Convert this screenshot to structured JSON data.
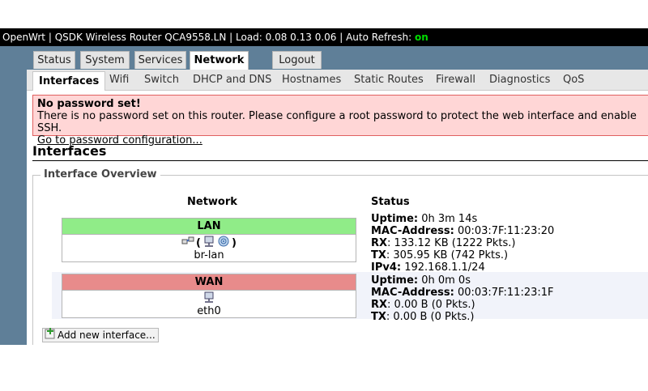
{
  "topbar": {
    "text": "OpenWrt | QSDK Wireless Router QCA9558.LN | Load: 0.08 0.13 0.06 | Auto Refresh: ",
    "auto_refresh": "on"
  },
  "main_tabs": [
    "Status",
    "System",
    "Services",
    "Network",
    "Logout"
  ],
  "sub_tabs": [
    "Interfaces",
    "Wifi",
    "Switch",
    "DHCP and DNS",
    "Hostnames",
    "Static Routes",
    "Firewall",
    "Diagnostics",
    "QoS"
  ],
  "alert": {
    "title": "No password set!",
    "message": "There is no password set on this router. Please configure a root password to protect the web interface and enable SSH.",
    "link": "Go to password configuration..."
  },
  "page_title": "Interfaces",
  "overview": {
    "legend": "Interface Overview",
    "col_network": "Network",
    "col_status": "Status",
    "lan": {
      "name": "LAN",
      "paren_open": "(",
      "paren_close": ")",
      "device": "br-lan",
      "status": [
        {
          "label": "Uptime:",
          "value": " 0h 3m 14s"
        },
        {
          "label": "MAC-Address:",
          "value": " 00:03:7F:11:23:20"
        },
        {
          "label": "RX",
          "value": ": 133.12 KB (1222 Pkts.)"
        },
        {
          "label": "TX",
          "value": ": 305.95 KB (742 Pkts.)"
        },
        {
          "label": "IPv4:",
          "value": " 192.168.1.1/24"
        }
      ]
    },
    "wan": {
      "name": "WAN",
      "device": "eth0",
      "status": [
        {
          "label": "Uptime:",
          "value": " 0h 0m 0s"
        },
        {
          "label": "MAC-Address:",
          "value": " 00:03:7F:11:23:1F"
        },
        {
          "label": "RX",
          "value": ": 0.00 B (0 Pkts.)"
        },
        {
          "label": "TX",
          "value": ": 0.00 B (0 Pkts.)"
        }
      ]
    },
    "add_button": "Add new interface..."
  },
  "icons": {
    "bridge": "bridge-icon",
    "ethernet": "ethernet-icon",
    "wifi": "wifi-icon",
    "add": "add-icon"
  },
  "colors": {
    "header_bg": "#000000",
    "nav_bg": "#5f7f98",
    "lan_green": "#90ec88",
    "wan_red": "#e88b8b",
    "alert_bg": "#ffd6d6",
    "auto_refresh_on": "#00dd00"
  }
}
